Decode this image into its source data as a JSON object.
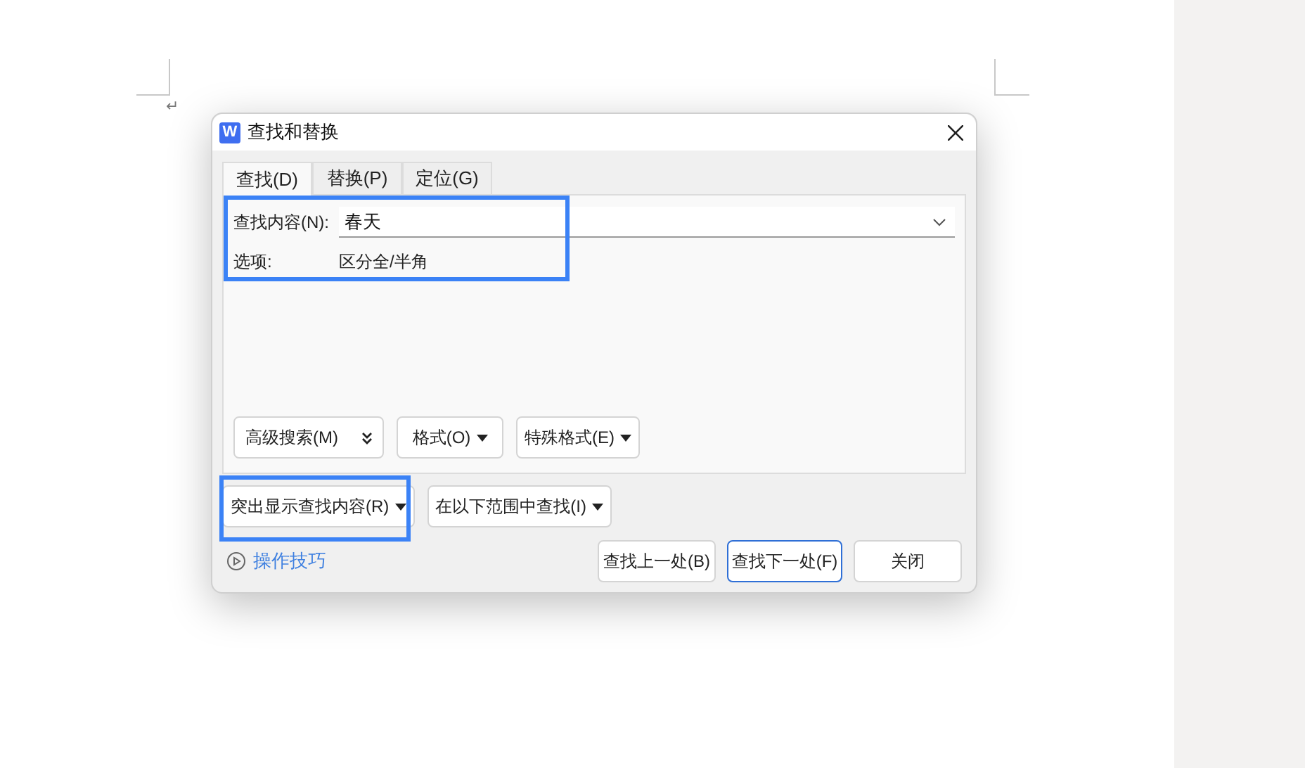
{
  "paragraph_mark": "↵",
  "window": {
    "app_icon_letter": "W",
    "title": "查找和替换"
  },
  "tabs": [
    {
      "label": "查找(D)",
      "selected": true
    },
    {
      "label": "替换(P)",
      "selected": false
    },
    {
      "label": "定位(G)",
      "selected": false
    }
  ],
  "find_field": {
    "label": "查找内容(N):",
    "value": "春天"
  },
  "options": {
    "label": "选项:",
    "value": "区分全/半角"
  },
  "panel_buttons": [
    {
      "label": "高级搜索(M)",
      "kind": "expand"
    },
    {
      "label": "格式(O)",
      "kind": "dropdown"
    },
    {
      "label": "特殊格式(E)",
      "kind": "dropdown"
    }
  ],
  "lower_buttons": [
    {
      "label": "突出显示查找内容(R)",
      "kind": "dropdown"
    },
    {
      "label": "在以下范围中查找(I)",
      "kind": "dropdown"
    }
  ],
  "tips_link": "操作技巧",
  "action_buttons": [
    {
      "label": "查找上一处(B)",
      "focused": false
    },
    {
      "label": "查找下一处(F)",
      "focused": true
    },
    {
      "label": "关闭",
      "focused": false
    }
  ]
}
